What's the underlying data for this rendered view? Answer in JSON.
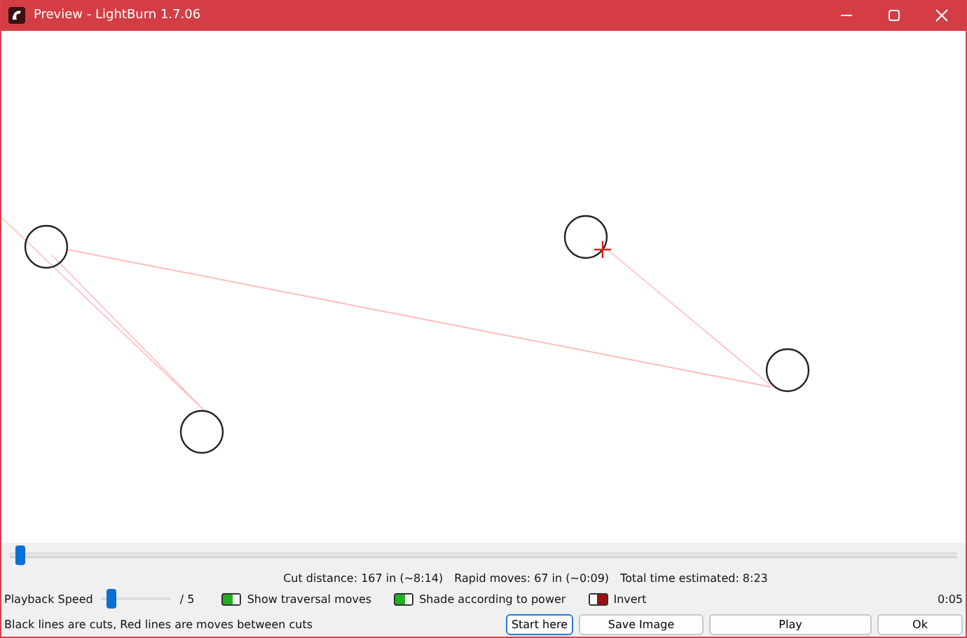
{
  "window": {
    "title": "Preview - LightBurn 1.7.06"
  },
  "position_slider": {
    "level": 0.01
  },
  "stats": [
    "Cut distance: 167 in (~8:14)",
    "Rapid moves: 67 in (~0:09)",
    "Total time estimated: 8:23"
  ],
  "playback_speed": {
    "label": "Playback Speed",
    "level": 0.13,
    "max": "/ 5"
  },
  "toggles": [
    {
      "label": "Show traversal moves",
      "on": true
    },
    {
      "label": "Shade according to power",
      "on": true
    },
    {
      "label": "Invert",
      "on": false
    }
  ],
  "time": "0:05",
  "hint": "Black lines are cuts, Red lines are moves between cuts",
  "buttons": [
    {
      "label": "Start here",
      "selected": true
    },
    {
      "label": "Save Image",
      "selected": false
    },
    {
      "label": "Play",
      "selected": false
    },
    {
      "label": "Ok",
      "selected": false
    }
  ]
}
